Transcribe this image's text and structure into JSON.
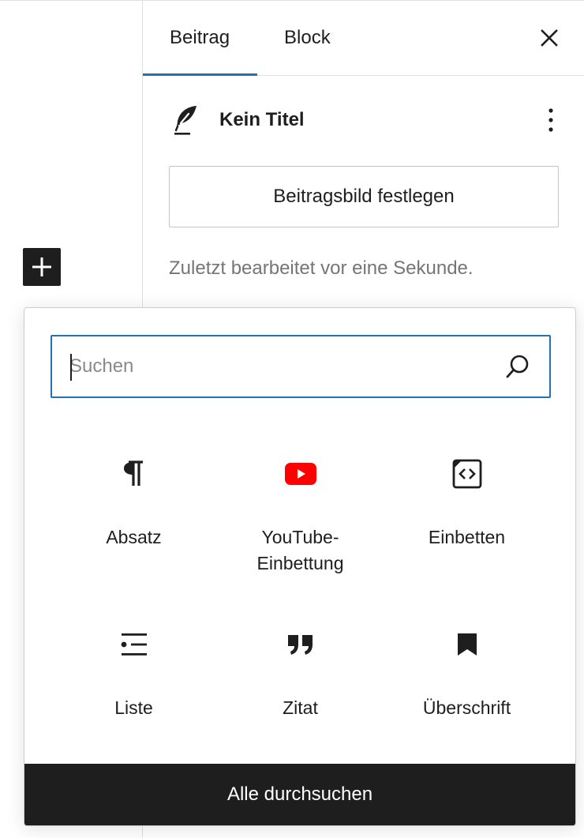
{
  "sidebar": {
    "tabs": [
      {
        "label": "Beitrag",
        "active": true
      },
      {
        "label": "Block",
        "active": false
      }
    ],
    "close_icon": "close-icon",
    "post": {
      "icon": "feather-icon",
      "title": "Kein Titel",
      "more_icon": "more-vertical-icon"
    },
    "featured_image_label": "Beitragsbild festlegen",
    "last_edited": "Zuletzt bearbeitet vor eine Sekunde."
  },
  "inserter_toggle": {
    "icon": "plus-icon"
  },
  "inserter": {
    "search": {
      "placeholder": "Suchen",
      "value": "",
      "icon": "search-icon"
    },
    "blocks": [
      {
        "label": "Absatz",
        "icon": "paragraph-icon"
      },
      {
        "label": "YouTube-Einbettung",
        "icon": "youtube-icon"
      },
      {
        "label": "Einbetten",
        "icon": "embed-icon"
      },
      {
        "label": "Liste",
        "icon": "list-icon"
      },
      {
        "label": "Zitat",
        "icon": "quote-icon"
      },
      {
        "label": "Überschrift",
        "icon": "bookmark-icon"
      }
    ],
    "browse_all_label": "Alle durchsuchen"
  },
  "colors": {
    "accent": "#2271b1",
    "dark": "#1e1e1e",
    "muted_text": "#757575",
    "youtube_red": "#ff0000"
  }
}
